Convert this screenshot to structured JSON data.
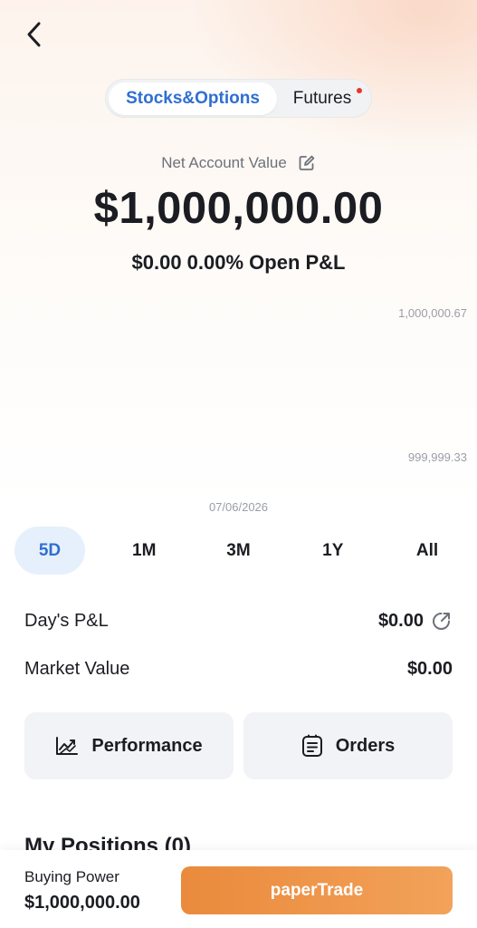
{
  "header": {
    "back_icon": "chevron-left-icon",
    "tabs": [
      {
        "label": "Stocks&Options",
        "active": true
      },
      {
        "label": "Futures",
        "active": false,
        "badge": "red-dot"
      }
    ]
  },
  "account": {
    "net_label": "Net Account Value",
    "edit_icon": "edit-icon",
    "net_value": "$1,000,000.00",
    "open_pnl": "$0.00 0.00% Open P&L"
  },
  "chart": {
    "y_max_label": "1,000,000.67",
    "y_min_label": "999,999.33",
    "date_label": "07/06/2026"
  },
  "ranges": [
    {
      "label": "5D",
      "active": true
    },
    {
      "label": "1M",
      "active": false
    },
    {
      "label": "3M",
      "active": false
    },
    {
      "label": "1Y",
      "active": false
    },
    {
      "label": "All",
      "active": false
    }
  ],
  "stats": {
    "days_pnl_label": "Day's P&L",
    "days_pnl_value": "$0.00",
    "share_icon": "share-icon",
    "market_value_label": "Market Value",
    "market_value_value": "$0.00"
  },
  "actions": {
    "performance_label": "Performance",
    "performance_icon": "trend-chart-icon",
    "orders_label": "Orders",
    "orders_icon": "orders-list-icon"
  },
  "positions": {
    "title": "My Positions (0)"
  },
  "footer": {
    "buying_power_label": "Buying Power",
    "buying_power_value": "$1,000,000.00",
    "trade_button_label": "paperTrade"
  },
  "colors": {
    "accent_blue": "#2f6fd1",
    "trade_orange": "#ea8a3c",
    "badge_red": "#e5362b"
  }
}
